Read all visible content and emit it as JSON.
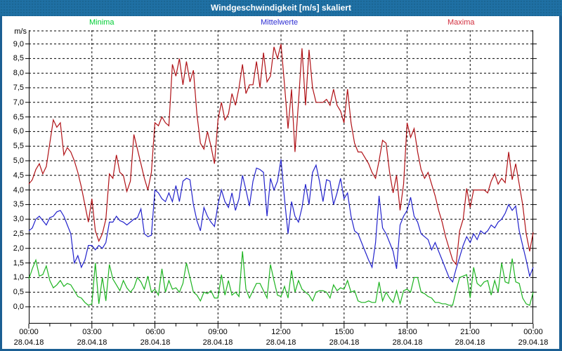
{
  "window": {
    "title": "Windgeschwindigkeit [m/s] skaliert"
  },
  "legend": {
    "items": [
      {
        "label": "Minima",
        "color": "#00cd35"
      },
      {
        "label": "Mittelwerte",
        "color": "#2f2fd3"
      },
      {
        "label": "Maxima",
        "color": "#d22f3f"
      }
    ]
  },
  "axis": {
    "unit_label": "m/s",
    "y_tick_labels": [
      "9,0",
      "8,5",
      "8,0",
      "7,5",
      "7,0",
      "6,5",
      "6,0",
      "5,5",
      "5,0",
      "4,5",
      "4,0",
      "3,5",
      "3,0",
      "2,5",
      "2,0",
      "1,5",
      "1,0",
      "0,5",
      "0,0"
    ],
    "x_ticks": [
      {
        "time": "00:00",
        "date": "28.04.18"
      },
      {
        "time": "03:00",
        "date": "28.04.18"
      },
      {
        "time": "06:00",
        "date": "28.04.18"
      },
      {
        "time": "09:00",
        "date": "28.04.18"
      },
      {
        "time": "12:00",
        "date": "28.04.18"
      },
      {
        "time": "15:00",
        "date": "28.04.18"
      },
      {
        "time": "18:00",
        "date": "28.04.18"
      },
      {
        "time": "21:00",
        "date": "28.04.18"
      },
      {
        "time": "00:00",
        "date": "29.04.18"
      }
    ],
    "x_minor_tick_every_hours": 1,
    "x_major_tick_every_hours": 3
  },
  "chart_data": {
    "type": "line",
    "title": "Windgeschwindigkeit [m/s] skaliert",
    "xlabel": "",
    "ylabel": "m/s",
    "ylim": [
      0,
      9
    ],
    "y_grid_step": 0.5,
    "x_grid_step_hours": 3,
    "x_start": "28.04.18 00:00",
    "x_end": "29.04.18 00:00",
    "sample_interval_minutes": 10,
    "grid": true,
    "legend_position": "top",
    "series": [
      {
        "name": "Minima",
        "color": "#1db320",
        "values": [
          0.95,
          1.3,
          1.6,
          1.05,
          1.1,
          1.4,
          0.9,
          0.65,
          0.75,
          0.9,
          0.7,
          0.8,
          0.75,
          0.55,
          0.35,
          0.3,
          0.15,
          0.05,
          0.1,
          1.5,
          0.1,
          1.0,
          0.2,
          1.45,
          0.95,
          0.75,
          0.55,
          0.9,
          0.65,
          0.5,
          0.65,
          1.0,
          0.85,
          0.6,
          1.05,
          0.5,
          0.6,
          0.4,
          1.3,
          0.5,
          0.9,
          0.6,
          0.65,
          0.5,
          0.8,
          1.5,
          1.0,
          0.5,
          0.4,
          0.2,
          0.5,
          0.45,
          0.55,
          0.3,
          0.3,
          1.1,
          0.4,
          0.9,
          0.4,
          0.5,
          0.35,
          1.9,
          0.6,
          0.3,
          0.55,
          0.8,
          0.8,
          0.55,
          0.3,
          1.45,
          0.9,
          0.4,
          0.35,
          0.7,
          0.3,
          1.25,
          0.5,
          0.9,
          0.6,
          0.5,
          0.4,
          0.2,
          0.5,
          0.55,
          0.55,
          0.5,
          0.3,
          0.75,
          0.55,
          0.65,
          0.6,
          0.9,
          0.5,
          0.55,
          0.2,
          0.15,
          0.15,
          0.2,
          0.15,
          0.15,
          0.85,
          0.2,
          0.5,
          0.3,
          0.15,
          0.55,
          0.1,
          0.55,
          0.6,
          0.5,
          1.0,
          1.0,
          0.5,
          0.45,
          0.35,
          0.3,
          0.15,
          0.15,
          0.1,
          0.1,
          0.05,
          0.05,
          0.55,
          1.0,
          1.05,
          1.1,
          0.3,
          1.35,
          0.8,
          0.7,
          0.85,
          0.9,
          0.4,
          0.9,
          0.5,
          1.5,
          0.85,
          0.8,
          1.65,
          0.85,
          0.8,
          0.3,
          0.1,
          0.05,
          0.5
        ]
      },
      {
        "name": "Mittelwerte",
        "color": "#2222cc",
        "values": [
          2.6,
          2.7,
          3.0,
          3.1,
          2.95,
          2.8,
          3.05,
          3.1,
          3.25,
          3.3,
          3.1,
          2.8,
          2.5,
          1.5,
          1.75,
          1.35,
          1.6,
          2.1,
          2.1,
          1.95,
          2.1,
          2.0,
          2.2,
          2.9,
          2.9,
          3.1,
          2.95,
          2.9,
          2.8,
          2.9,
          3.0,
          3.05,
          3.35,
          2.5,
          2.4,
          2.45,
          4.0,
          3.9,
          3.7,
          3.6,
          3.9,
          3.6,
          4.15,
          3.6,
          4.3,
          4.4,
          4.35,
          3.5,
          2.95,
          2.6,
          3.4,
          3.1,
          2.9,
          2.75,
          3.5,
          4.0,
          3.6,
          3.4,
          3.9,
          3.3,
          3.7,
          4.5,
          4.0,
          3.45,
          4.3,
          4.75,
          4.7,
          4.6,
          3.1,
          4.4,
          4.0,
          4.3,
          5.05,
          3.7,
          2.5,
          3.6,
          3.1,
          2.9,
          3.4,
          4.2,
          3.5,
          4.6,
          4.85,
          4.3,
          3.6,
          4.35,
          4.3,
          3.5,
          3.9,
          4.4,
          3.7,
          3.9,
          3.1,
          2.6,
          2.5,
          2.2,
          1.9,
          1.6,
          1.35,
          2.2,
          3.8,
          2.7,
          2.5,
          2.2,
          1.9,
          1.3,
          2.8,
          3.1,
          3.3,
          3.75,
          3.1,
          2.9,
          2.5,
          2.4,
          2.3,
          1.95,
          2.2,
          1.9,
          1.6,
          1.3,
          1.0,
          0.85,
          1.3,
          1.7,
          2.1,
          2.4,
          2.2,
          2.5,
          2.3,
          2.6,
          2.5,
          2.6,
          2.8,
          2.7,
          2.9,
          3.0,
          3.2,
          3.5,
          3.3,
          3.45,
          2.6,
          2.1,
          1.6,
          1.05,
          1.35
        ]
      },
      {
        "name": "Maxima",
        "color": "#b01116",
        "values": [
          4.2,
          4.35,
          4.7,
          4.9,
          4.55,
          4.8,
          5.6,
          6.4,
          6.15,
          6.3,
          5.2,
          5.45,
          5.3,
          5.0,
          4.6,
          4.1,
          3.5,
          2.9,
          3.7,
          2.6,
          2.25,
          2.5,
          3.0,
          4.55,
          4.4,
          5.2,
          4.6,
          4.5,
          3.95,
          4.3,
          5.9,
          5.4,
          4.9,
          4.4,
          4.0,
          4.6,
          6.3,
          6.2,
          6.5,
          6.3,
          6.2,
          8.3,
          7.9,
          8.5,
          7.6,
          8.4,
          7.7,
          8.1,
          6.6,
          5.6,
          5.4,
          6.0,
          5.5,
          4.9,
          6.4,
          7.0,
          6.4,
          6.6,
          7.3,
          6.9,
          7.5,
          8.3,
          7.3,
          7.6,
          7.6,
          8.4,
          7.5,
          8.7,
          7.7,
          7.9,
          8.9,
          8.5,
          9.0,
          7.6,
          6.1,
          7.45,
          5.3,
          7.0,
          8.85,
          6.9,
          8.8,
          7.5,
          7.0,
          7.0,
          7.0,
          7.1,
          6.9,
          7.45,
          6.9,
          6.7,
          6.3,
          7.45,
          6.3,
          5.6,
          5.3,
          5.3,
          5.1,
          4.9,
          4.6,
          4.4,
          5.0,
          5.7,
          5.6,
          4.6,
          3.9,
          4.5,
          3.3,
          4.2,
          6.3,
          5.8,
          6.1,
          5.3,
          4.7,
          4.4,
          4.6,
          4.2,
          3.8,
          3.3,
          2.9,
          2.4,
          2.0,
          1.6,
          1.45,
          2.6,
          3.0,
          4.05,
          3.4,
          4.0,
          4.0,
          4.0,
          4.0,
          3.9,
          4.3,
          4.55,
          4.2,
          4.4,
          4.25,
          5.3,
          4.35,
          4.9,
          4.2,
          3.5,
          2.5,
          1.9,
          2.55
        ]
      }
    ]
  }
}
